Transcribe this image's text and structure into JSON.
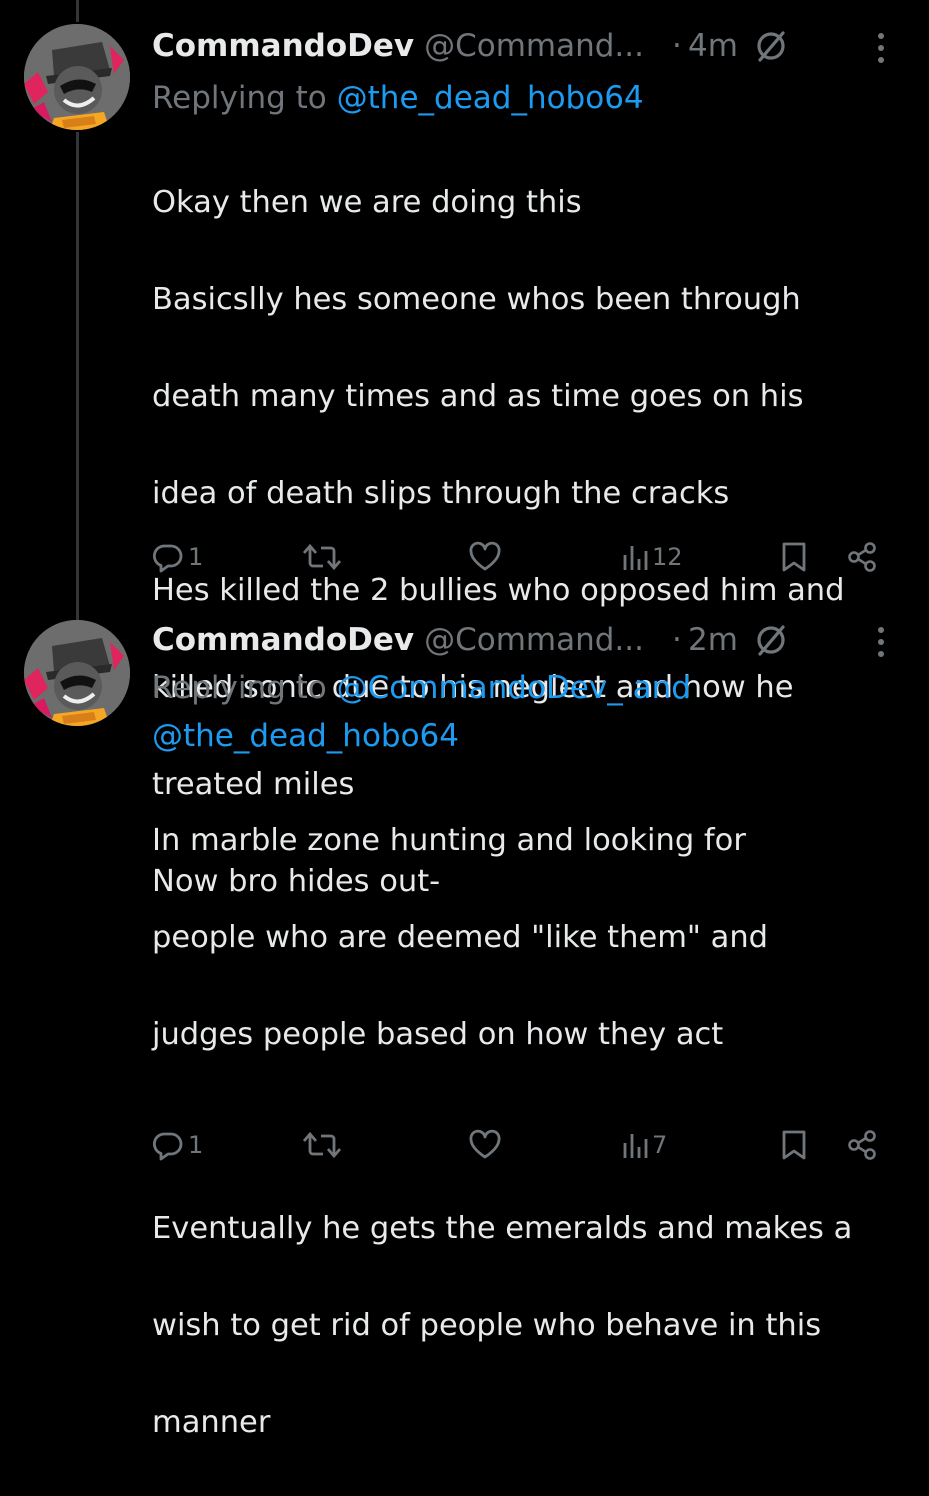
{
  "posts": [
    {
      "display_name": "CommandoDev",
      "handle": "@Command...",
      "time": "4m",
      "reply_prefix": "Replying to",
      "reply_mentions_line1": "@the_dead_hobo64",
      "reply_mentions_line2": "",
      "reply_and": "",
      "body_lines": [
        "Okay then we are doing this",
        "Basicslly hes someone whos been through",
        "death many times and as time goes on his",
        "idea of death slips through the cracks",
        "Hes killed the 2 bullies who opposed him and",
        "killed sonic due to his neglect and how he",
        "treated miles",
        "Now bro hides out-"
      ],
      "replies": "1",
      "reposts": "",
      "likes": "",
      "views": "12"
    },
    {
      "display_name": "CommandoDev",
      "handle": "@Command...",
      "time": "2m",
      "reply_prefix": "Replying to",
      "reply_mentions_line1": "@CommandoDev_ and",
      "reply_mentions_line2": "@the_dead_hobo64",
      "body_lines": [
        "In marble zone hunting and looking for",
        "people who are deemed \"like them\" and",
        "judges people based on how they act",
        "",
        "Eventually he gets the emeralds and makes a",
        "wish to get rid of people who behave in this",
        "manner"
      ],
      "replies": "1",
      "reposts": "",
      "likes": "",
      "views": "7"
    }
  ],
  "icons": {
    "reply": "reply-icon",
    "repost": "repost-icon",
    "like": "heart-icon",
    "views": "views-icon",
    "bookmark": "bookmark-icon",
    "share": "share-icon",
    "more": "more-icon",
    "audience": "circle-slash-icon"
  },
  "colors": {
    "background": "#000000",
    "text": "#e7e9ea",
    "secondary": "#71767b",
    "link": "#1d9bf0",
    "thread_line": "#333639"
  }
}
